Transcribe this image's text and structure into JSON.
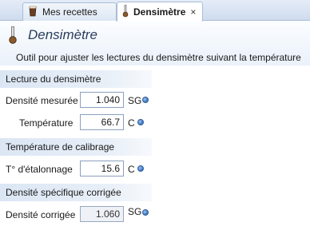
{
  "tabs": [
    {
      "label": "Mes recettes",
      "active": false,
      "icon": "beer-glass-icon"
    },
    {
      "label": "Densimètre",
      "active": true,
      "icon": "hydrometer-icon",
      "close": "×"
    }
  ],
  "header": {
    "title": "Densimètre",
    "subtitle": "Outil pour ajuster les lectures du densimètre suivant la température"
  },
  "sections": {
    "reading": {
      "title": "Lecture du densimètre",
      "measured_density": {
        "label": "Densité mesurée",
        "value": "1.040",
        "unit": "SG"
      },
      "temperature": {
        "label": "Température",
        "value": "66.7",
        "unit": "C"
      }
    },
    "calibration": {
      "title": "Température de calibrage",
      "calibration_temp": {
        "label": "T° d'étalonnage",
        "value": "15.6",
        "unit": "C"
      }
    },
    "corrected": {
      "title": "Densité spécifique corrigée",
      "corrected_density": {
        "label": "Densité corrigée",
        "value": "1.060",
        "unit": "SG"
      }
    }
  },
  "colors": {
    "accent": "#3a74c2",
    "section_bg": "#dbe6f4",
    "title_text": "#2a3d5c"
  }
}
